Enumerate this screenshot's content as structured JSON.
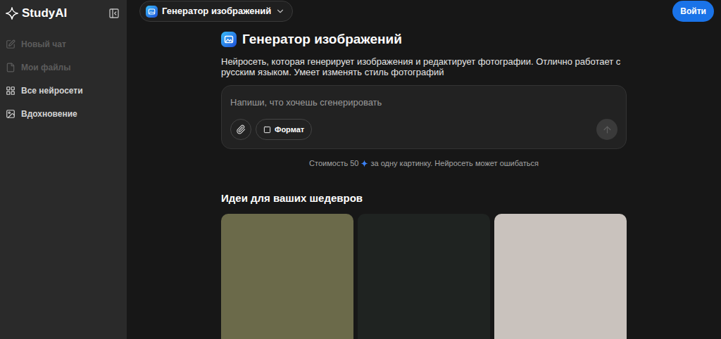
{
  "sidebar": {
    "logo": "StudyAI",
    "items": [
      {
        "label": "Новый чат",
        "disabled": true
      },
      {
        "label": "Мои файлы",
        "disabled": true
      },
      {
        "label": "Все нейросети",
        "disabled": false
      },
      {
        "label": "Вдохновение",
        "disabled": false
      }
    ]
  },
  "model_selector": {
    "label": "Генератор изображений"
  },
  "login_button": "Войти",
  "header": {
    "title": "Генератор изображений",
    "description": "Нейросеть, которая генерирует изображения и редактирует фотографии. Отлично работает с русским языком. Умеет изменять стиль фотографий"
  },
  "prompt": {
    "placeholder": "Напиши, что хочешь сгенерировать",
    "format_button": "Формат",
    "send_disabled": true
  },
  "cost": {
    "prefix": "Стоимость 50",
    "suffix": "за одну картинку. Нейросеть может ошибаться"
  },
  "ideas": {
    "title": "Идеи для ваших шедевров",
    "items": [
      {
        "color": "#6b6a4a"
      },
      {
        "color": "#1f2321"
      },
      {
        "color": "#c9c2bd"
      }
    ]
  }
}
